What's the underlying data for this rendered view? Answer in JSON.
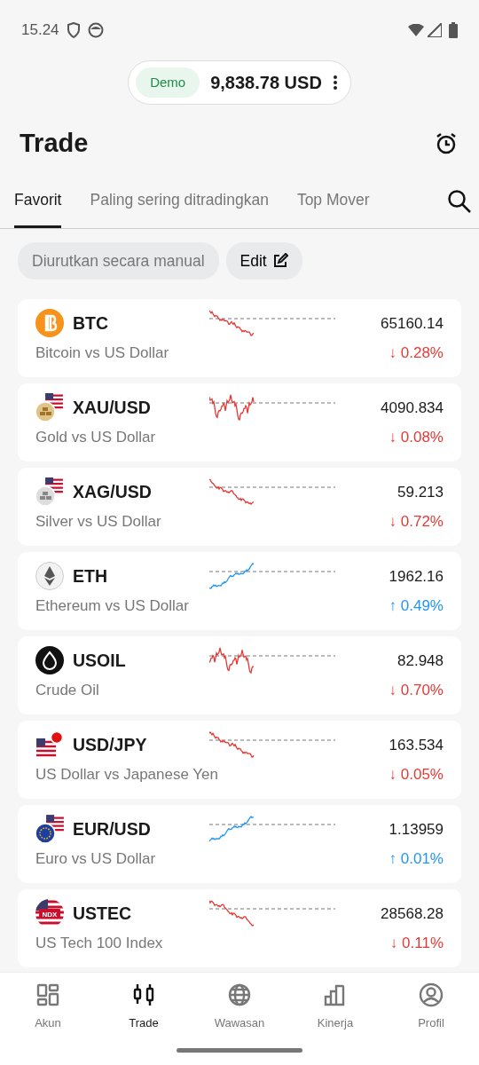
{
  "status_bar": {
    "time": "15.24"
  },
  "account": {
    "badge": "Demo",
    "balance": "9,838.78 USD"
  },
  "title": "Trade",
  "tabs": [
    {
      "label": "Favorit",
      "selected": true
    },
    {
      "label": "Paling sering ditradingkan",
      "selected": false
    },
    {
      "label": "Top Mover",
      "selected": false
    }
  ],
  "filters": [
    {
      "label": "Diurutkan secara manual",
      "kind": "sort"
    },
    {
      "label": "Edit",
      "kind": "edit"
    }
  ],
  "instruments": [
    {
      "symbol": "BTC",
      "name": "Bitcoin vs US Dollar",
      "price": "65160.14",
      "change": "↓ 0.28%",
      "rising": false,
      "kind": "bitcoin"
    },
    {
      "symbol": "XAU/USD",
      "name": "Gold vs US Dollar",
      "price": "4090.834",
      "change": "↓ 0.08%",
      "rising": false,
      "kind": "gold"
    },
    {
      "symbol": "XAG/USD",
      "name": "Silver vs US Dollar",
      "price": "59.213",
      "change": "↓ 0.72%",
      "rising": false,
      "kind": "silver"
    },
    {
      "symbol": "ETH",
      "name": "Ethereum vs US Dollar",
      "price": "1962.16",
      "change": "↑ 0.49%",
      "rising": true,
      "kind": "ether"
    },
    {
      "symbol": "USOIL",
      "name": "Crude Oil",
      "price": "82.948",
      "change": "↓ 0.70%",
      "rising": false,
      "kind": "oil"
    },
    {
      "symbol": "USD/JPY",
      "name": "US Dollar vs Japanese Yen",
      "price": "163.534",
      "change": "↓ 0.05%",
      "rising": false,
      "kind": "yen"
    },
    {
      "symbol": "EUR/USD",
      "name": "Euro vs US Dollar",
      "price": "1.13959",
      "change": "↑ 0.01%",
      "rising": true,
      "kind": "euro"
    },
    {
      "symbol": "USTEC",
      "name": "US Tech 100 Index",
      "price": "28568.28",
      "change": "↓ 0.11%",
      "rising": false,
      "kind": "index",
      "badge": "NDX"
    }
  ],
  "bottom_nav": [
    {
      "label": "Akun",
      "selected": false,
      "kind": "account"
    },
    {
      "label": "Trade",
      "selected": true,
      "kind": "trade"
    },
    {
      "label": "Wawasan",
      "selected": false,
      "kind": "insights"
    },
    {
      "label": "Kinerja",
      "selected": false,
      "kind": "performance"
    },
    {
      "label": "Profil",
      "selected": false,
      "kind": "profile"
    }
  ]
}
